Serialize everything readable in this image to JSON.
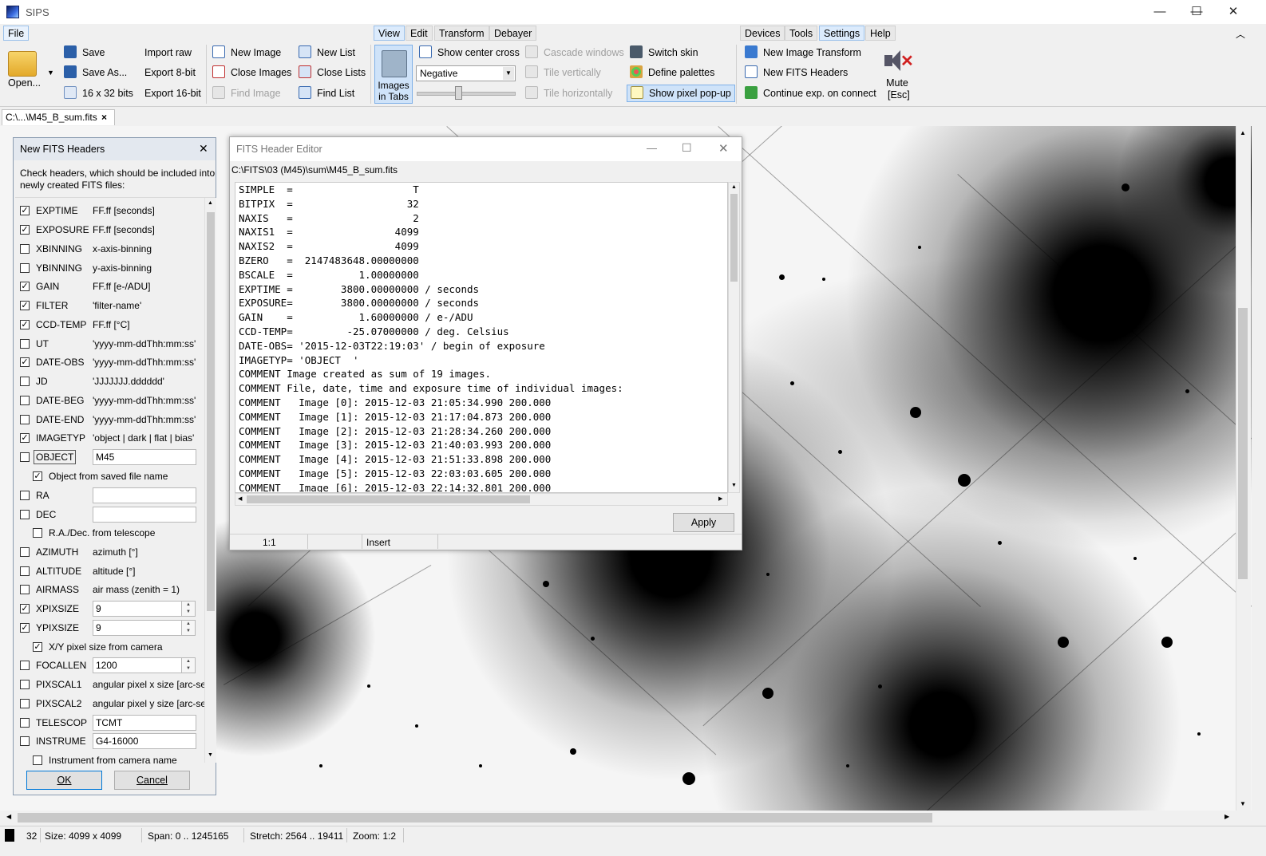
{
  "window": {
    "title": "SIPS",
    "minimize": "—",
    "maximize": "☐",
    "close": "✕"
  },
  "ribbon_tabs": [
    {
      "label": "File"
    },
    {
      "label": "View"
    },
    {
      "label": "Edit"
    },
    {
      "label": "Transform"
    },
    {
      "label": "Debayer"
    },
    {
      "label": "Devices"
    },
    {
      "label": "Tools"
    },
    {
      "label": "Settings"
    },
    {
      "label": "Help"
    }
  ],
  "file_group": {
    "open": "Open...",
    "save": "Save",
    "save_as": "Save As...",
    "bits": "16 x 32 bits",
    "import_raw": "Import raw",
    "export8": "Export 8-bit",
    "export16": "Export 16-bit",
    "new_image": "New Image",
    "close_images": "Close Images",
    "find_image": "Find Image",
    "new_list": "New List",
    "close_lists": "Close Lists",
    "find_list": "Find List"
  },
  "view_group": {
    "images_in_tabs": "Images in Tabs",
    "show_center_cross": "Show center cross",
    "palette": "Negative",
    "cascade": "Cascade windows",
    "tile_v": "Tile vertically",
    "tile_h": "Tile horizontally",
    "switch_skin": "Switch skin",
    "define_palettes": "Define palettes",
    "show_pixel_popup": "Show pixel pop-up"
  },
  "settings_group": {
    "new_image_transform": "New Image Transform",
    "new_fits_headers": "New FITS Headers",
    "continue_exp": "Continue exp. on connect",
    "mute": "Mute",
    "mute_key": "[Esc]"
  },
  "doc_tab": {
    "label": "C:\\...\\M45_B_sum.fits",
    "close": "×"
  },
  "nfh": {
    "title": "New FITS Headers",
    "close": "✕",
    "desc1": "Check headers, which should be included into",
    "desc2": "newly created FITS files:",
    "ok": "OK",
    "cancel": "Cancel",
    "rows": [
      {
        "name": "EXPTIME",
        "value": "FF.ff [seconds]",
        "checked": "✓"
      },
      {
        "name": "EXPOSURE",
        "value": "FF.ff [seconds]",
        "checked": "✓"
      },
      {
        "name": "XBINNING",
        "value": "x-axis-binning",
        "checked": ""
      },
      {
        "name": "YBINNING",
        "value": "y-axis-binning",
        "checked": ""
      },
      {
        "name": "GAIN",
        "value": "FF.ff [e-/ADU]",
        "checked": "✓"
      },
      {
        "name": "FILTER",
        "value": "'filter-name'",
        "checked": "✓"
      },
      {
        "name": "CCD-TEMP",
        "value": "FF.ff [°C]",
        "checked": "✓"
      },
      {
        "name": "UT",
        "value": "'yyyy-mm-ddThh:mm:ss'",
        "checked": ""
      },
      {
        "name": "DATE-OBS",
        "value": "'yyyy-mm-ddThh:mm:ss'",
        "checked": "✓"
      },
      {
        "name": "JD",
        "value": "'JJJJJJJ.dddddd'",
        "checked": ""
      },
      {
        "name": "DATE-BEG",
        "value": "'yyyy-mm-ddThh:mm:ss'",
        "checked": ""
      },
      {
        "name": "DATE-END",
        "value": "'yyyy-mm-ddThh:mm:ss'",
        "checked": ""
      },
      {
        "name": "IMAGETYP",
        "value": "'object | dark | flat | bias'",
        "checked": "✓"
      }
    ],
    "object_name": "OBJECT",
    "object_value": "M45",
    "object_from_file": "Object from saved file name",
    "object_from_file_checked": "✓",
    "ra": "RA",
    "dec": "DEC",
    "radec_from_scope": "R.A./Dec. from telescope",
    "rows2": [
      {
        "name": "AZIMUTH",
        "value": "azimuth [°]",
        "checked": ""
      },
      {
        "name": "ALTITUDE",
        "value": "altitude [°]",
        "checked": ""
      },
      {
        "name": "AIRMASS",
        "value": "air mass (zenith = 1)",
        "checked": ""
      }
    ],
    "xpix": "XPIXSIZE",
    "xpix_val": "9",
    "ypix": "YPIXSIZE",
    "ypix_val": "9",
    "xy_from_cam": "X/Y pixel size from camera",
    "focallen": "FOCALLEN",
    "focallen_val": "1200",
    "pixscal1": "PIXSCAL1",
    "pixscal1_val": "angular pixel x size [arc-sec]",
    "pixscal2": "PIXSCAL2",
    "pixscal2_val": "angular pixel y size [arc-sec]",
    "telescop": "TELESCOP",
    "telescop_val": "TCMT",
    "instrume": "INSTRUME",
    "instrume_val": "G4-16000",
    "instr_from_cam": "Instrument from camera name"
  },
  "fhe": {
    "title": "FITS Header Editor",
    "path": "C:\\FITS\\03 (M45)\\sum\\M45_B_sum.fits",
    "lines": [
      "SIMPLE  =                    T",
      "BITPIX  =                   32",
      "NAXIS   =                    2",
      "NAXIS1  =                 4099",
      "NAXIS2  =                 4099",
      "BZERO   =  2147483648.00000000",
      "BSCALE  =           1.00000000",
      "EXPTIME =        3800.00000000 / seconds",
      "EXPOSURE=        3800.00000000 / seconds",
      "GAIN    =           1.60000000 / e-/ADU",
      "CCD-TEMP=         -25.07000000 / deg. Celsius",
      "DATE-OBS= '2015-12-03T22:19:03' / begin of exposure",
      "IMAGETYP= 'OBJECT  '",
      "COMMENT Image created as sum of 19 images.",
      "COMMENT File, date, time and exposure time of individual images:",
      "COMMENT   Image [0]: 2015-12-03 21:05:34.990 200.000",
      "COMMENT   Image [1]: 2015-12-03 21:17:04.873 200.000",
      "COMMENT   Image [2]: 2015-12-03 21:28:34.260 200.000",
      "COMMENT   Image [3]: 2015-12-03 21:40:03.993 200.000",
      "COMMENT   Image [4]: 2015-12-03 21:51:33.898 200.000",
      "COMMENT   Image [5]: 2015-12-03 22:03:03.605 200.000",
      "COMMENT   Image [6]: 2015-12-03 22:14:32.801 200.000"
    ],
    "apply": "Apply",
    "status_pos": "1:1",
    "status_mode": "Insert"
  },
  "status": {
    "bits": "32",
    "size": "Size: 4099 x 4099",
    "span": "Span: 0 .. 1245165",
    "stretch": "Stretch: 2564 .. 19411",
    "zoom": "Zoom: 1:2"
  }
}
